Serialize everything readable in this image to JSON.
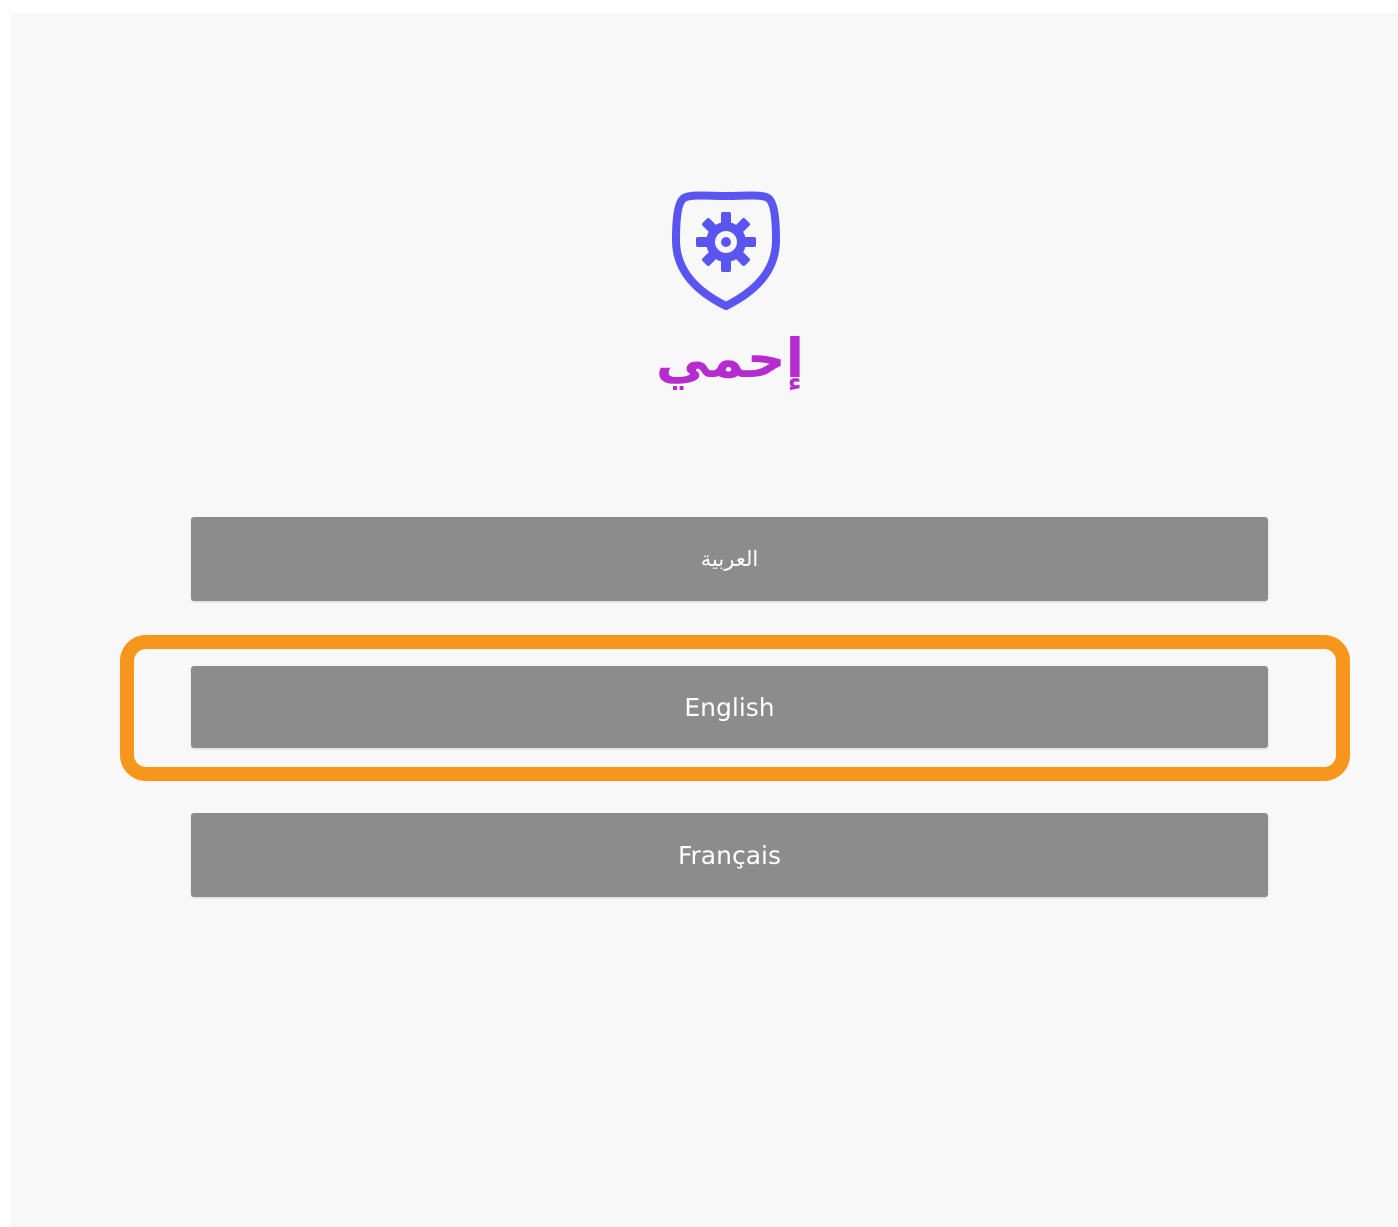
{
  "app": {
    "brand_name": "إحمي",
    "logo_icon": "shield-gear-icon",
    "brand_colors": {
      "logo": "#5a55f0",
      "name_start": "#9b2fe0",
      "name_end": "#e0249c"
    }
  },
  "language_options": [
    {
      "label": "العربية",
      "code": "ar"
    },
    {
      "label": "English",
      "code": "en",
      "highlighted": true
    },
    {
      "label": "Français",
      "code": "fr"
    }
  ],
  "colors": {
    "background": "#f8f8f8",
    "button": "#8c8c8c",
    "button_text": "#ffffff",
    "highlight": "#f7961d"
  }
}
